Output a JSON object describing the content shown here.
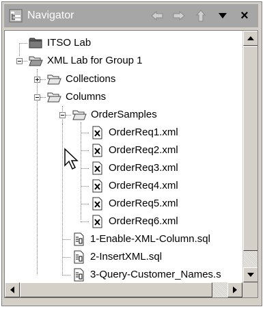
{
  "window": {
    "title": "Navigator",
    "buttons": [
      {
        "name": "back-button",
        "icon": "arrow-left-icon"
      },
      {
        "name": "forward-button",
        "icon": "arrow-right-icon"
      },
      {
        "name": "up-button",
        "icon": "arrow-up-icon"
      },
      {
        "name": "view-menu-button",
        "icon": "triangle-down-icon"
      },
      {
        "name": "close-button",
        "icon": "close-icon",
        "label": "×"
      }
    ]
  },
  "tree": {
    "items": [
      {
        "label": "ITSO Lab",
        "icon": "project-icon"
      },
      {
        "label": "XML Lab for Group 1",
        "icon": "open-folder-icon",
        "state": "expanded"
      },
      {
        "label": "Collections",
        "icon": "folder-icon",
        "state": "collapsed"
      },
      {
        "label": "Columns",
        "icon": "open-folder-icon",
        "state": "expanded"
      },
      {
        "label": "OrderSamples",
        "icon": "open-folder-icon",
        "state": "expanded"
      },
      {
        "label": "OrderReq1.xml",
        "icon": "xml-file-icon"
      },
      {
        "label": "OrderReq2.xml",
        "icon": "xml-file-icon"
      },
      {
        "label": "OrderReq3.xml",
        "icon": "xml-file-icon"
      },
      {
        "label": "OrderReq4.xml",
        "icon": "xml-file-icon"
      },
      {
        "label": "OrderReq5.xml",
        "icon": "xml-file-icon"
      },
      {
        "label": "OrderReq6.xml",
        "icon": "xml-file-icon"
      },
      {
        "label": "1-Enable-XML-Column.sql",
        "icon": "sql-file-icon"
      },
      {
        "label": "2-InsertXML.sql",
        "icon": "sql-file-icon"
      },
      {
        "label": "3-Query-Customer_Names.s",
        "icon": "sql-file-icon"
      }
    ]
  },
  "colors": {
    "titlebar": "#a6a6a6",
    "chrome": "#d4d0c8",
    "tree_background": "#ffffff"
  }
}
